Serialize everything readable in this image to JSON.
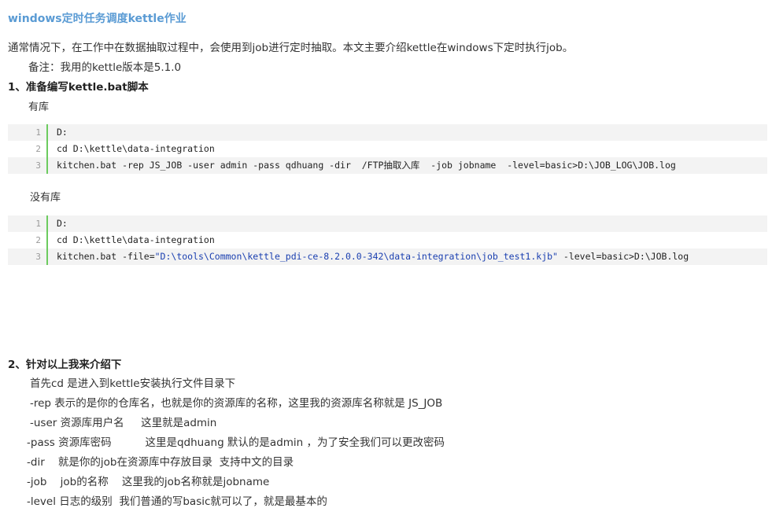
{
  "article": {
    "title": "windows定时任务调度kettle作业",
    "intro": "通常情况下，在工作中在数据抽取过程中，会使用到job进行定时抽取。本文主要介绍kettle在windows下定时执行job。",
    "note": "备注：我用的kettle版本是5.1.0",
    "section1_title": "1、准备编写kettle.bat脚本",
    "with_repo_label": "有库",
    "without_repo_label": "没有库",
    "section2_title": "2、针对以上我来介绍下",
    "explanations": [
      "首先cd 是进入到kettle安装执行文件目录下",
      "-rep 表示的是你的仓库名，也就是你的资源库的名称，这里我的资源库名称就是 JS_JOB",
      "-user 资源库用户名     这里就是admin",
      "-pass 资源库密码          这里是qdhuang 默认的是admin ，为了安全我们可以更改密码",
      "-dir    就是你的job在资源库中存放目录  支持中文的目录",
      "-job    job的名称    这里我的job名称就是jobname",
      "-level 日志的级别  我们普通的写basic就可以了，就是最基本的"
    ]
  },
  "code_block_1": {
    "lines": [
      {
        "num": "1",
        "text": "D:"
      },
      {
        "num": "2",
        "text": "cd D:\\kettle\\data-integration"
      },
      {
        "num": "3",
        "text": "kitchen.bat -rep JS_JOB -user admin -pass qdhuang -dir  /FTP抽取入库  -job jobname  -level=basic>D:\\JOB_LOG\\JOB.log"
      }
    ]
  },
  "code_block_2": {
    "lines": [
      {
        "num": "1",
        "text": "D:"
      },
      {
        "num": "2",
        "text": "cd D:\\kettle\\data-integration"
      },
      {
        "num": "3",
        "pre": "kitchen.bat -file=",
        "string": "\"D:\\tools\\Common\\kettle_pdi-ce-8.2.0.0-342\\data-integration\\job_test1.kjb\"",
        "post": " -level=basic>D:\\JOB.log"
      }
    ]
  },
  "colors": {
    "title": "#5a9bd4",
    "gutter_bar": "#6ccb5f",
    "code_bg": "#f3f3f3",
    "string": "#1a3fb0"
  }
}
